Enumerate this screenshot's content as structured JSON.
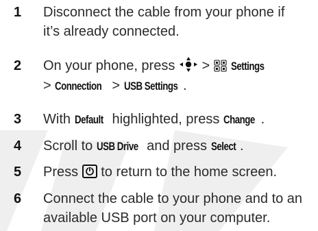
{
  "steps": [
    {
      "number": "1",
      "line1": "Disconnect the cable from your phone if",
      "line2": "it’s already connected."
    },
    {
      "number": "2",
      "line1_a": "On your phone, press",
      "separator": ">",
      "settings_label": "Settings",
      "connection_label": "Connection",
      "usb_settings_label": "USB Settings",
      "period": "."
    },
    {
      "number": "3",
      "text_a": "With",
      "default_label": "Default",
      "text_b": "highlighted, press",
      "change_label": "Change",
      "period": "."
    },
    {
      "number": "4",
      "text_a": "Scroll to",
      "usb_drive_label": "USB Drive",
      "text_b": "and press",
      "select_label": "Select",
      "period": "."
    },
    {
      "number": "5",
      "text_a": "Press",
      "text_b": "to return to the home screen."
    },
    {
      "number": "6",
      "line1": "Connect the cable to your phone and to an",
      "line2": "available USB port on your computer."
    }
  ],
  "icons": {
    "nav_key": "navigation-key-icon",
    "settings": "settings-icon",
    "home_key": "home-key-icon"
  }
}
